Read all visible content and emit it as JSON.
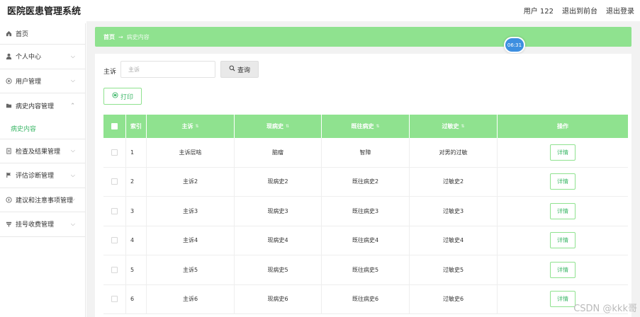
{
  "header": {
    "title": "医院医患管理系统",
    "user": "用户 122",
    "to_front": "退出到前台",
    "logout": "退出登录"
  },
  "sidebar": {
    "items": [
      {
        "label": "首页",
        "icon": "home-icon"
      },
      {
        "label": "个人中心",
        "icon": "user-icon"
      },
      {
        "label": "用户管理",
        "icon": "users-icon"
      },
      {
        "label": "病史内容管理",
        "icon": "folder-icon"
      },
      {
        "label": "检查及结果管理",
        "icon": "report-icon"
      },
      {
        "label": "评估诊断管理",
        "icon": "flag-icon"
      },
      {
        "label": "建议和注意事项管理",
        "icon": "compass-icon"
      },
      {
        "label": "挂号收费管理",
        "icon": "payment-icon"
      }
    ],
    "submenu": "病史内容"
  },
  "breadcrumb": {
    "home": "首页",
    "arrow": "→",
    "current": "病史内容"
  },
  "timer": "06:31",
  "search": {
    "label": "主诉",
    "placeholder": "主诉",
    "button": "查询"
  },
  "print_button": "打印",
  "table": {
    "headers": [
      "索引",
      "主诉",
      "现病史",
      "既往病史",
      "过敏史",
      "操作"
    ],
    "rows": [
      {
        "index": "1",
        "complaint": "主诉层啥",
        "present": "脑瘤",
        "past": "智障",
        "allergy": "对男的过敏",
        "action": "详情"
      },
      {
        "index": "2",
        "complaint": "主诉2",
        "present": "现病史2",
        "past": "既往病史2",
        "allergy": "过敏史2",
        "action": "详情"
      },
      {
        "index": "3",
        "complaint": "主诉3",
        "present": "现病史3",
        "past": "既往病史3",
        "allergy": "过敏史3",
        "action": "详情"
      },
      {
        "index": "4",
        "complaint": "主诉4",
        "present": "现病史4",
        "past": "既往病史4",
        "allergy": "过敏史4",
        "action": "详情"
      },
      {
        "index": "5",
        "complaint": "主诉5",
        "present": "现病史5",
        "past": "既往病史5",
        "allergy": "过敏史5",
        "action": "详情"
      },
      {
        "index": "6",
        "complaint": "主诉6",
        "present": "现病史6",
        "past": "既往病史6",
        "allergy": "过敏史6",
        "action": "详情"
      }
    ]
  },
  "watermark": "CSDN @kkk哥",
  "colors": {
    "accent": "#8fe28f",
    "accent_text": "#3fb86a",
    "timer": "#3d8fe0"
  }
}
